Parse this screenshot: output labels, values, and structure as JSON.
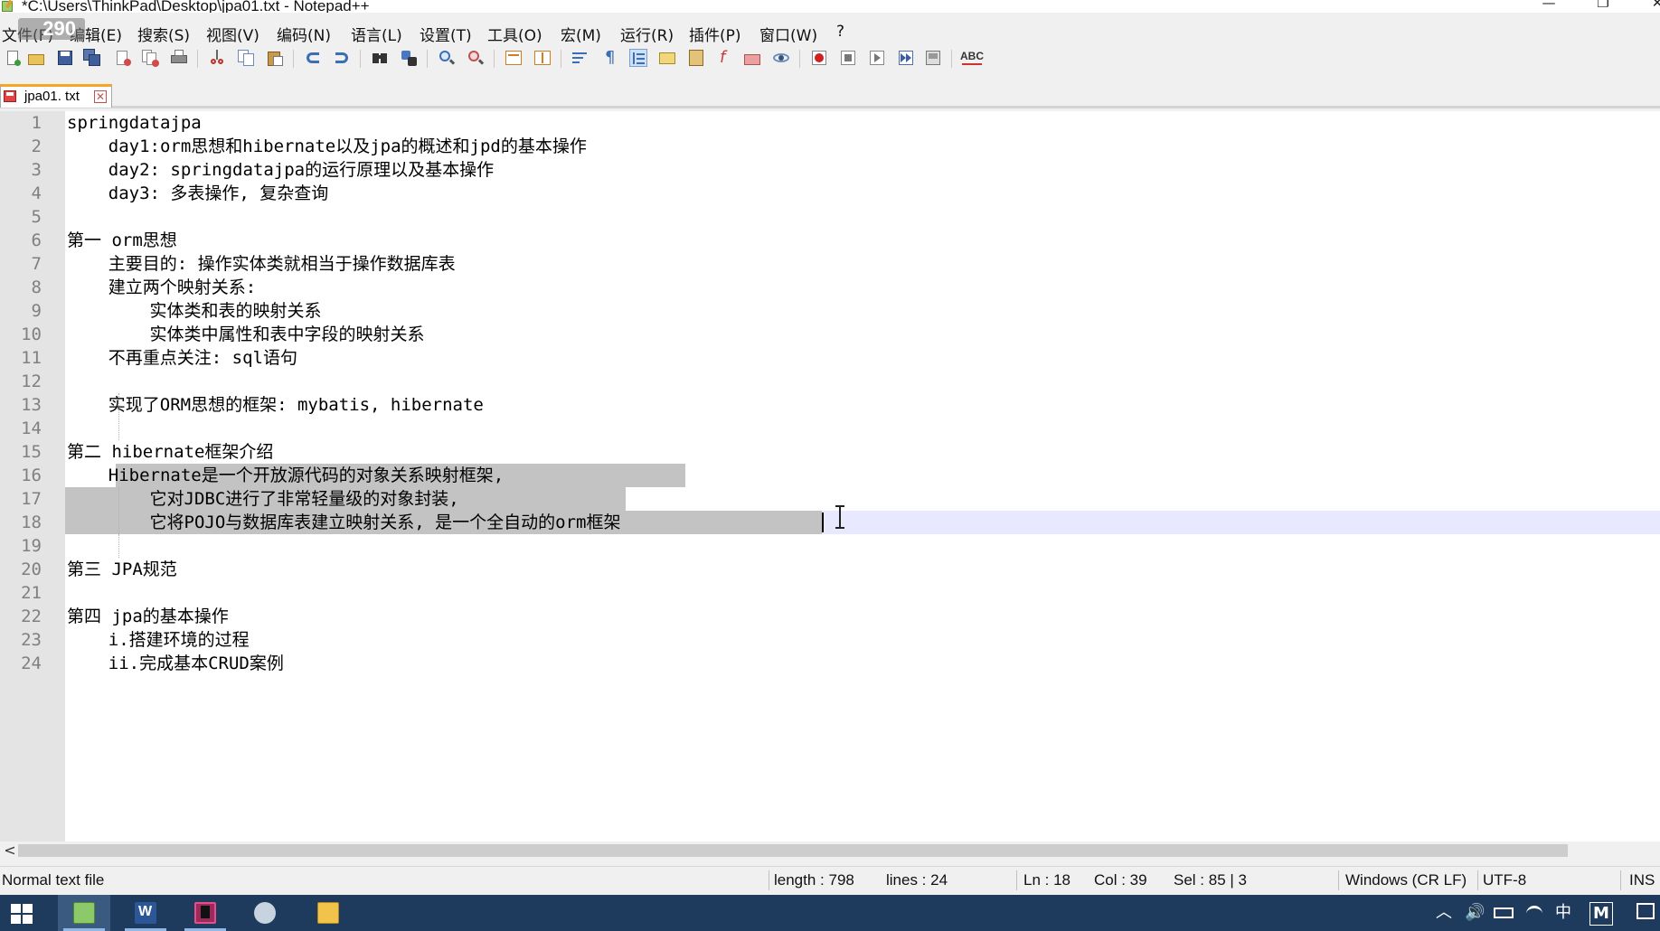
{
  "window": {
    "title": "*C:\\Users\\ThinkPad\\Desktop\\jpa01.txt - Notepad++",
    "minimize": "—",
    "maximize": "❐",
    "close": "✕"
  },
  "overlay_badge": "290",
  "menu": [
    "文件(F)",
    "编辑(E)",
    "搜索(S)",
    "视图(V)",
    "编码(N)",
    "语言(L)",
    "设置(T)",
    "工具(O)",
    "宏(M)",
    "运行(R)",
    "插件(P)",
    "窗口(W)",
    "?"
  ],
  "toolbar": {
    "spell_label": "ABC",
    "icons": [
      "new-file-icon",
      "open-file-icon",
      "save-icon",
      "save-all-icon",
      "close-icon",
      "close-all-icon",
      "print-icon",
      "cut-icon",
      "copy-icon",
      "paste-icon",
      "undo-icon",
      "redo-icon",
      "find-icon",
      "replace-icon",
      "zoom-in-icon",
      "zoom-out-icon",
      "sync-vertical-icon",
      "sync-horizontal-icon",
      "word-wrap-icon",
      "show-all-chars-icon",
      "indent-guide-icon",
      "udl-icon",
      "doc-map-icon",
      "function-list-icon",
      "folder-workspace-icon",
      "monitoring-icon",
      "record-macro-icon",
      "stop-macro-icon",
      "play-macro-icon",
      "run-macro-multiple-icon",
      "save-macro-icon",
      "spell-check-icon"
    ]
  },
  "tab": {
    "label": "jpa01. txt",
    "close_glyph": "✕"
  },
  "editor": {
    "lines": [
      "springdatajpa",
      "    day1:orm思想和hibernate以及jpa的概述和jpd的基本操作",
      "    day2: springdatajpa的运行原理以及基本操作",
      "    day3: 多表操作, 复杂查询",
      "",
      "第一 orm思想",
      "    主要目的: 操作实体类就相当于操作数据库表",
      "    建立两个映射关系:",
      "        实体类和表的映射关系",
      "        实体类中属性和表中字段的映射关系",
      "    不再重点关注: sql语句",
      "",
      "    实现了ORM思想的框架: mybatis, hibernate",
      "",
      "第二 hibernate框架介绍",
      "    Hibernate是一个开放源代码的对象关系映射框架,",
      "        它对JDBC进行了非常轻量级的对象封装,",
      "        它将POJO与数据库表建立映射关系, 是一个全自动的orm框架",
      "",
      "第三 JPA规范",
      "",
      "第四 jpa的基本操作",
      "    i.搭建环境的过程",
      "    ii.完成基本CRUD案例"
    ]
  },
  "scrollbar": {
    "left_arrow": "<"
  },
  "statusbar": {
    "file_type": "Normal text file",
    "length": "length : 798",
    "lines": "lines : 24",
    "ln": "Ln : 18",
    "col": "Col : 39",
    "sel": "Sel : 85 | 3",
    "eol": "Windows (CR LF)",
    "encoding": "UTF-8",
    "mode": "INS"
  },
  "taskbar": {
    "apps": [
      "notepad-plus-plus",
      "word",
      "intellij-idea",
      "feather-app",
      "file-explorer"
    ],
    "tray": {
      "chevron": "︿",
      "volume": "🔊",
      "ime": "中",
      "ime_mode": "M"
    }
  },
  "colors": {
    "selection": "#c3c3c3",
    "current_line": "#e8e8ff",
    "gutter": "#e4e4e4",
    "tab_accent": "#f5a623",
    "taskbar": "#1e3a5c"
  }
}
